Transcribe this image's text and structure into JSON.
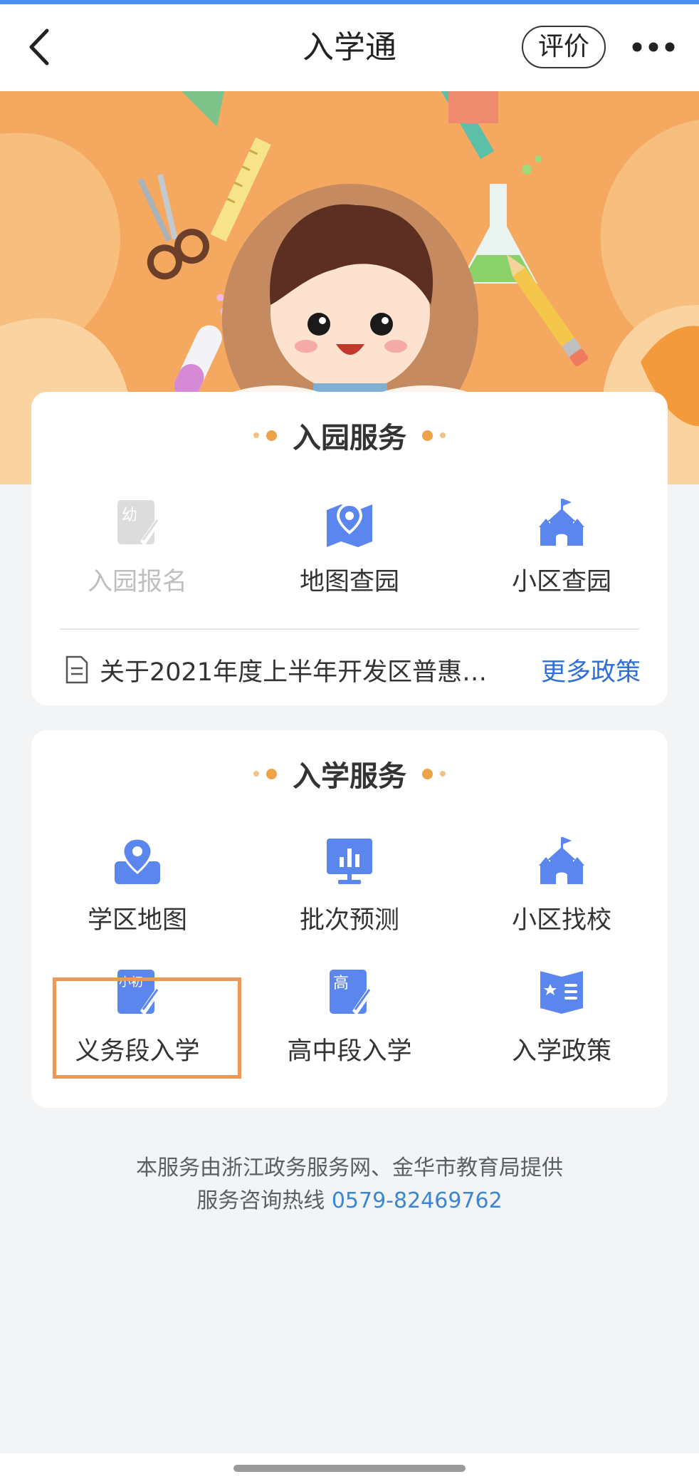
{
  "nav": {
    "title": "入学通",
    "rate_label": "评价",
    "back_icon": "chevron-left-icon",
    "more_icon": "more-dots-icon"
  },
  "banner": {
    "illustration": "child-reading-book-illustration"
  },
  "kindergarten": {
    "title": "入园服务",
    "services": [
      {
        "label": "入园报名",
        "icon": "kindergarten-signup-icon",
        "enabled": false
      },
      {
        "label": "地图查园",
        "icon": "map-pin-icon",
        "enabled": true
      },
      {
        "label": "小区查园",
        "icon": "castle-icon",
        "enabled": true
      }
    ],
    "policy_text": "关于2021年度上半年开发区普惠…",
    "policy_more": "更多政策"
  },
  "school": {
    "title": "入学服务",
    "services": [
      {
        "label": "学区地图",
        "icon": "map-location-icon"
      },
      {
        "label": "批次预测",
        "icon": "chart-board-icon"
      },
      {
        "label": "小区找校",
        "icon": "castle-icon"
      },
      {
        "label": "义务段入学",
        "icon": "primary-middle-signup-icon",
        "badge": "小初"
      },
      {
        "label": "高中段入学",
        "icon": "high-school-signup-icon",
        "badge": "高"
      },
      {
        "label": "入学政策",
        "icon": "policy-book-icon"
      }
    ]
  },
  "footer": {
    "line1": "本服务由浙江政务服务网、金华市教育局提供",
    "line2_prefix": "服务咨询热线",
    "phone": "0579-82469762"
  },
  "colors": {
    "accent_blue": "#5b86ee",
    "banner_orange": "#f4a860",
    "highlight": "#e89a5c",
    "link_blue": "#2f6fd6"
  }
}
